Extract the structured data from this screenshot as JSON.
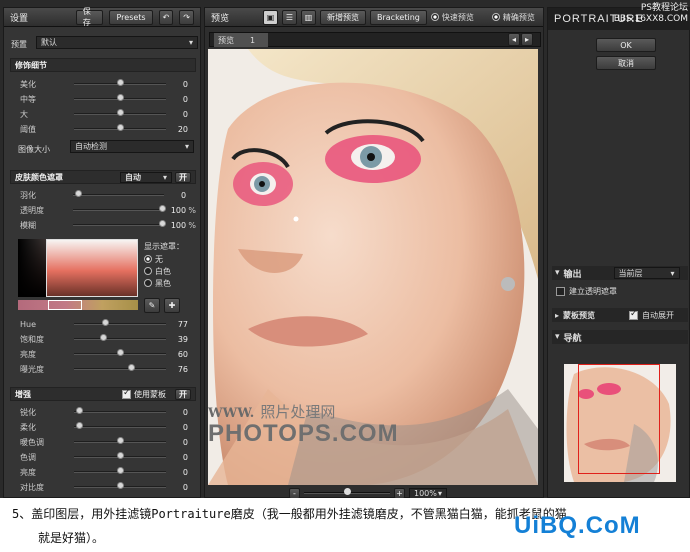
{
  "watermark_top": {
    "line1": "PS教程论坛",
    "line2": "BBS.16XX8.COM"
  },
  "left_panel": {
    "title": "设置",
    "save": "保存",
    "presets": "Presets",
    "preset_label": "预置",
    "preset_value": "默认",
    "detail": {
      "title": "修饰细节",
      "rows": [
        {
          "label": "美化",
          "value": "0",
          "pos": 0.5
        },
        {
          "label": "中等",
          "value": "0",
          "pos": 0.5
        },
        {
          "label": "大",
          "value": "0",
          "pos": 0.5
        },
        {
          "label": "阈值",
          "value": "20",
          "pos": 0.5
        }
      ],
      "size_label": "图像大小",
      "size_value": "自动检测"
    },
    "skin": {
      "title": "皮肤颜色遮罩",
      "mode": "自动",
      "open": "开",
      "rows": [
        {
          "label": "羽化",
          "value": "0",
          "pos": 0.02,
          "unit": ""
        },
        {
          "label": "透明度",
          "value": "100",
          "pos": 1.0,
          "unit": "%"
        },
        {
          "label": "模糊",
          "value": "100",
          "pos": 1.0,
          "unit": "%"
        }
      ],
      "display_label": "显示遮罩：",
      "radios": [
        {
          "label": "无",
          "selected": true
        },
        {
          "label": "白色",
          "selected": false
        },
        {
          "label": "黑色",
          "selected": false
        }
      ],
      "hsl": [
        {
          "label": "Hue",
          "value": "77",
          "pos": 0.32
        },
        {
          "label": "饱和度",
          "value": "39",
          "pos": 0.3
        },
        {
          "label": "亮度",
          "value": "60",
          "pos": 0.5
        },
        {
          "label": "曝光度",
          "value": "76",
          "pos": 0.63
        }
      ]
    },
    "enhance": {
      "title": "增强",
      "use_mask": "使用蒙板",
      "open": "开",
      "rows": [
        {
          "label": "锐化",
          "value": "0",
          "pos": 0.02
        },
        {
          "label": "柔化",
          "value": "0",
          "pos": 0.02
        },
        {
          "label": "暖色调",
          "value": "0",
          "pos": 0.5
        },
        {
          "label": "色调",
          "value": "0",
          "pos": 0.5
        },
        {
          "label": "亮度",
          "value": "0",
          "pos": 0.5
        },
        {
          "label": "对比度",
          "value": "0",
          "pos": 0.5
        }
      ]
    }
  },
  "center": {
    "preview_label": "预览",
    "new_preview": "新增预览",
    "bracketing": "Bracketing",
    "fast_preview": "快速预览",
    "precise_preview": "精确预览",
    "tab": "预览",
    "tab_num": "1",
    "zoom": "100%",
    "minus": "-",
    "plus": "+",
    "watermark_url": "WWW.",
    "watermark_cn": "照片处理网",
    "watermark_brand": "PHOTOPS.COM"
  },
  "right_panel": {
    "brand": "PORTRAITURE",
    "ok": "OK",
    "cancel": "取消",
    "output_label": "输出",
    "output_value": "当前层",
    "transparent_mask": "建立透明遮罩",
    "mask_preview": "蒙板预览",
    "auto_expand": "自动展开",
    "nav": "导航"
  },
  "caption": {
    "line1": "5、盖印图层，用外挂滤镜Portraiture磨皮（我一般都用外挂滤镜磨皮，不管黑猫白猫，能抓老鼠的猫",
    "line2": "就是好猫）。",
    "logo": "UiBQ.CoM"
  }
}
